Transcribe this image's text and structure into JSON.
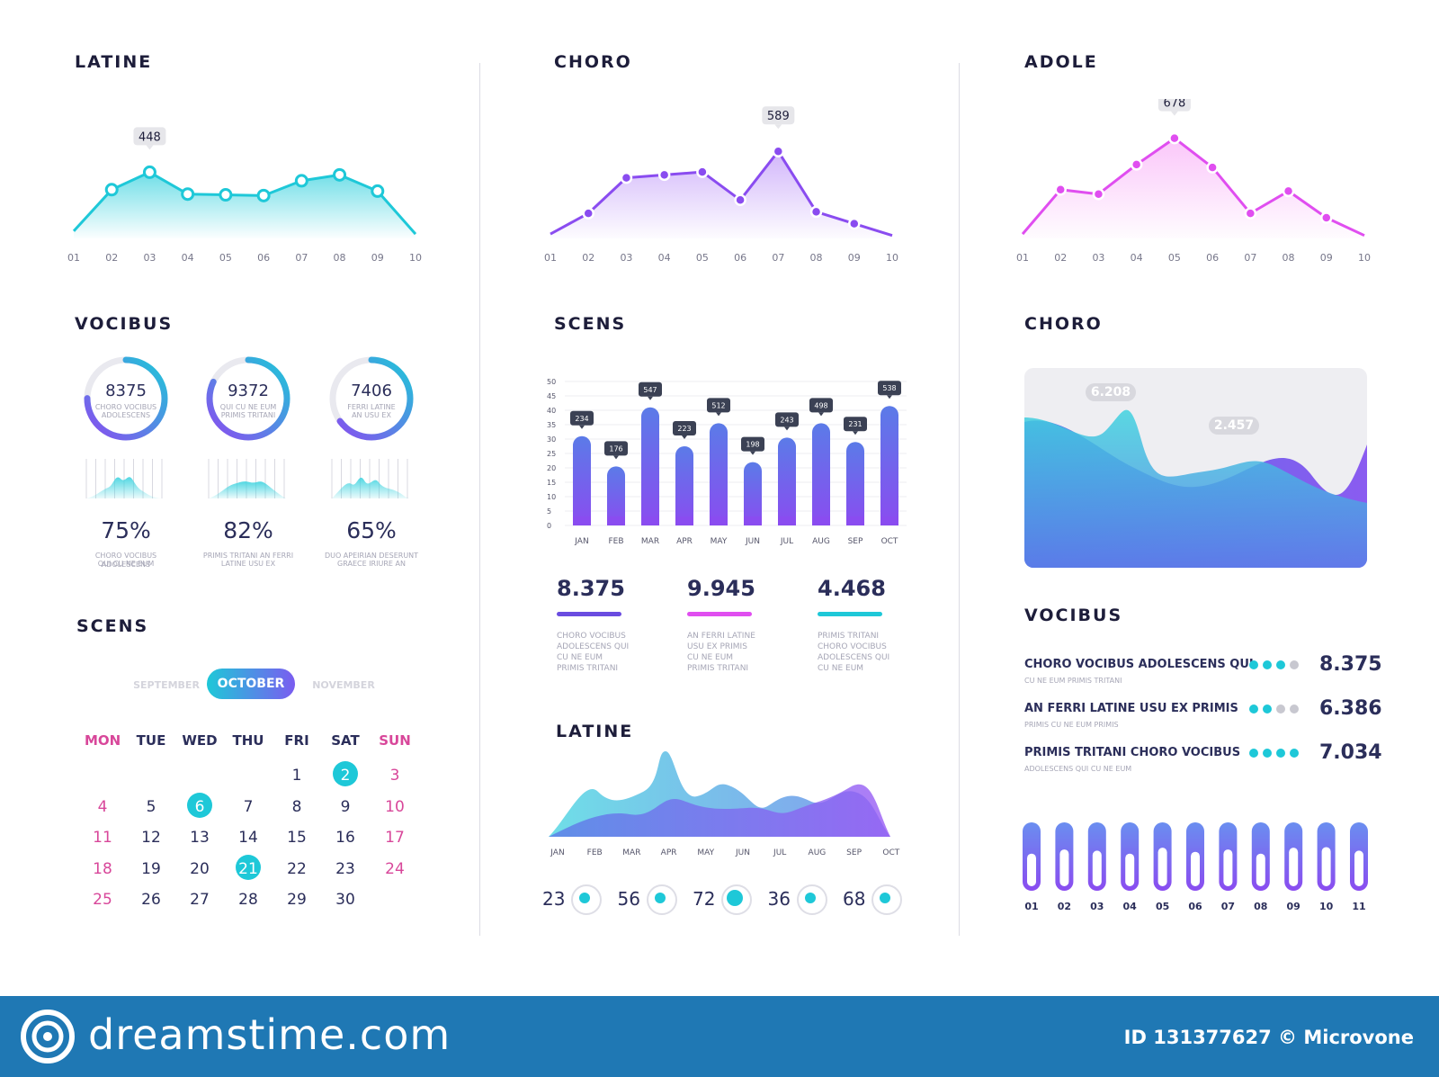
{
  "sections": {
    "latine_top": "LATINE",
    "choro_top": "CHORO",
    "adole_top": "ADOLE",
    "vocibus_left": "VOCIBUS",
    "scens_mid": "SCENS",
    "choro_right": "CHORO",
    "scens_left": "SCENS",
    "latine_mid": "LATINE",
    "vocibus_right": "VOCIBUS"
  },
  "colors": {
    "cyan": "#1ec8d8",
    "purple": "#8a4cf0",
    "magenta": "#e04ef0",
    "navy": "#2b2e5a",
    "indigo": "#5a5ee8"
  },
  "chart_data": [
    {
      "type": "area",
      "title": "LATINE",
      "x": [
        "01",
        "02",
        "03",
        "04",
        "05",
        "06",
        "07",
        "08",
        "09",
        "10"
      ],
      "values": [
        50,
        330,
        448,
        300,
        295,
        290,
        390,
        430,
        320,
        30
      ],
      "callout": {
        "index": 2,
        "label": "448"
      },
      "color": "#1ec8d8"
    },
    {
      "type": "line",
      "title": "CHORO",
      "x": [
        "01",
        "02",
        "03",
        "04",
        "05",
        "06",
        "07",
        "08",
        "09",
        "10"
      ],
      "values": [
        30,
        170,
        410,
        430,
        450,
        260,
        589,
        180,
        100,
        20
      ],
      "callout": {
        "index": 6,
        "label": "589"
      },
      "color": "#8a4cf0"
    },
    {
      "type": "line",
      "title": "ADOLE",
      "x": [
        "01",
        "02",
        "03",
        "04",
        "05",
        "06",
        "07",
        "08",
        "09",
        "10"
      ],
      "values": [
        30,
        330,
        300,
        500,
        678,
        480,
        170,
        320,
        140,
        20
      ],
      "callout": {
        "index": 4,
        "label": "678"
      },
      "color": "#e04ef0"
    },
    {
      "type": "bar",
      "title": "SCENS",
      "categories": [
        "JAN",
        "FEB",
        "MAR",
        "APR",
        "MAY",
        "JUN",
        "JUL",
        "AUG",
        "SEP",
        "OCT"
      ],
      "values": [
        31,
        20.5,
        41,
        27.5,
        35.5,
        22,
        30.5,
        35.5,
        29,
        41.5
      ],
      "labels": [
        "234",
        "176",
        "547",
        "223",
        "512",
        "198",
        "243",
        "498",
        "231",
        "538"
      ],
      "yticks": [
        "50",
        "45",
        "40",
        "35",
        "30",
        "25",
        "20",
        "15",
        "10",
        "5",
        "0"
      ],
      "ylim": [
        0,
        50
      ]
    },
    {
      "type": "area",
      "title": "CHORO",
      "callouts": [
        "6.208",
        "2.457"
      ]
    },
    {
      "type": "area",
      "title": "LATINE",
      "categories": [
        "JAN",
        "FEB",
        "MAR",
        "APR",
        "MAY",
        "JUN",
        "JUL",
        "AUG",
        "SEP",
        "OCT"
      ]
    },
    {
      "type": "bar",
      "title": "VOCIBUS",
      "categories": [
        "01",
        "02",
        "03",
        "04",
        "05",
        "06",
        "07",
        "08",
        "09",
        "10",
        "11"
      ],
      "values": [
        0.55,
        0.62,
        0.6,
        0.55,
        0.65,
        0.58,
        0.62,
        0.55,
        0.65,
        0.66,
        0.6
      ]
    }
  ],
  "donuts": [
    {
      "value": "8375",
      "caption1": "CHORO VOCIBUS",
      "caption2": "ADOLESCENS",
      "progress": 0.75,
      "pct": "75%",
      "note1": "CHORO VOCIBUS ADOLESCENS",
      "note2": "QUI CU NE EUM"
    },
    {
      "value": "9372",
      "caption1": "QUI CU NE EUM",
      "caption2": "PRIMIS TRITANI",
      "progress": 0.82,
      "pct": "82%",
      "note1": "PRIMIS TRITANI AN FERRI",
      "note2": "LATINE USU EX"
    },
    {
      "value": "7406",
      "caption1": "FERRI LATINE",
      "caption2": "AN USU EX",
      "progress": 0.65,
      "pct": "65%",
      "note1": "DUO APEIRIAN DESERUNT",
      "note2": "GRAECE IRIURE AN"
    }
  ],
  "stats": [
    {
      "value": "8.375",
      "color": "#6a4ce0",
      "lines": [
        "CHORO VOCIBUS",
        "ADOLESCENS QUI",
        "CU NE EUM",
        "PRIMIS TRITANI"
      ]
    },
    {
      "value": "9.945",
      "color": "#e04ef0",
      "lines": [
        "AN FERRI LATINE",
        "USU EX PRIMIS",
        "CU NE EUM",
        "PRIMIS TRITANI"
      ]
    },
    {
      "value": "4.468",
      "color": "#1ec8d8",
      "lines": [
        "PRIMIS TRITANI",
        "CHORO VOCIBUS",
        "ADOLESCENS QUI",
        "CU NE EUM"
      ]
    }
  ],
  "mini_stats": [
    "23",
    "56",
    "72",
    "36",
    "68"
  ],
  "calendar": {
    "months": {
      "prev": "SEPTEMBER",
      "current": "OCTOBER",
      "next": "NOVEMBER"
    },
    "weekdays": [
      "MON",
      "TUE",
      "WED",
      "THU",
      "FRI",
      "SAT",
      "SUN"
    ],
    "weeks": [
      [
        "",
        "",
        "",
        "",
        "1",
        "2",
        "3"
      ],
      [
        "4",
        "5",
        "6",
        "7",
        "8",
        "9",
        "10"
      ],
      [
        "11",
        "12",
        "13",
        "14",
        "15",
        "16",
        "17"
      ],
      [
        "18",
        "19",
        "20",
        "21",
        "22",
        "23",
        "24"
      ],
      [
        "25",
        "26",
        "27",
        "28",
        "29",
        "30",
        ""
      ]
    ],
    "highlighted": [
      "2",
      "6",
      "21"
    ]
  },
  "vocibus_list": [
    {
      "title": "CHORO VOCIBUS ADOLESCENS QUI",
      "sub": "CU NE EUM PRIMIS TRITANI",
      "dots": 3,
      "value": "8.375"
    },
    {
      "title": "AN FERRI LATINE USU EX PRIMIS",
      "sub": "PRIMIS CU NE EUM PRIMIS",
      "dots": 2,
      "value": "6.386"
    },
    {
      "title": "PRIMIS TRITANI CHORO VOCIBUS",
      "sub": "ADOLESCENS QUI CU NE EUM",
      "dots": 4,
      "value": "7.034"
    }
  ],
  "footer": {
    "brand": "dreamstime.com",
    "id_text": "ID 131377627 © Microvone"
  }
}
